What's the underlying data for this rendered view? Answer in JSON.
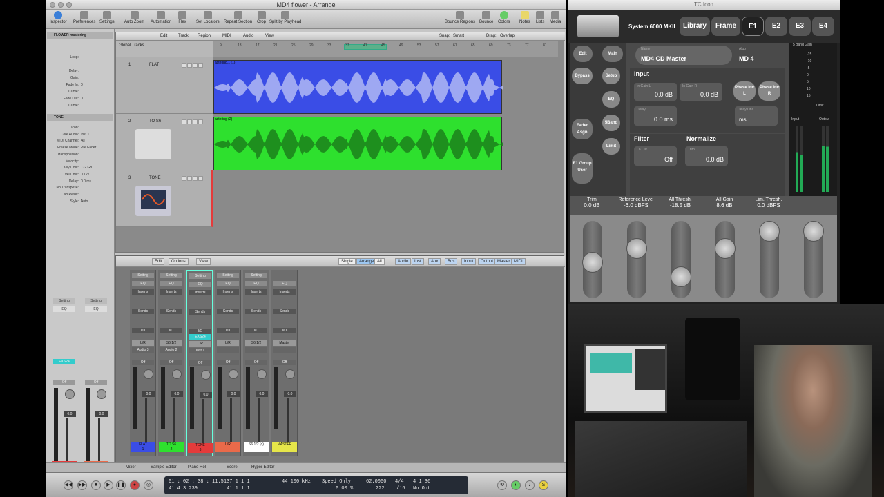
{
  "window": {
    "title": "MD4 flower - Arrange"
  },
  "toolbar": {
    "left": [
      "Inspector",
      "Preferences",
      "Settings"
    ],
    "center": [
      "Auto Zoom",
      "Automation",
      "Flex",
      "Set Locators",
      "Repeat Section",
      "Crop",
      "Split by Playhead"
    ],
    "right": [
      "Bounce Regions",
      "Bounce",
      "Colors",
      "Notes",
      "Lists",
      "Media"
    ]
  },
  "inspector": {
    "region_title": "FLOWER mastering",
    "region_params": [
      {
        "k": "Loop:",
        "v": ""
      },
      {
        "k": "Delay:",
        "v": ""
      },
      {
        "k": "Gain:",
        "v": ""
      },
      {
        "k": "Fade In:",
        "v": "0"
      },
      {
        "k": "Curve:",
        "v": ""
      },
      {
        "k": "Fade Out:",
        "v": "0"
      },
      {
        "k": "Curve:",
        "v": ""
      }
    ],
    "track_title": "TONE",
    "track_params": [
      {
        "k": "Icon:",
        "v": ""
      },
      {
        "k": "Core Audio:",
        "v": "Inst 1"
      },
      {
        "k": "MIDI Channel:",
        "v": "All"
      },
      {
        "k": "Freeze Mode:",
        "v": "Pre Fader"
      },
      {
        "k": "Transposition:",
        "v": ""
      },
      {
        "k": "Velocity:",
        "v": ""
      },
      {
        "k": "Key Limit:",
        "v": "C-2  G8"
      },
      {
        "k": "Vel Limit:",
        "v": "0   127"
      },
      {
        "k": "Delay:",
        "v": "0.0 ms"
      },
      {
        "k": "No Transpose:",
        "v": ""
      },
      {
        "k": "No Reset:",
        "v": ""
      },
      {
        "k": "Style:",
        "v": "Auto"
      }
    ]
  },
  "arrange": {
    "menus": [
      "Edit",
      "Track",
      "Region",
      "MIDI",
      "Audio",
      "View"
    ],
    "snap_label": "Snap:",
    "snap_value": "Smart",
    "drag_label": "Drag:",
    "drag_value": "Overlap",
    "global_tracks": "Global Tracks",
    "ruler": [
      "9",
      "13",
      "17",
      "21",
      "25",
      "29",
      "33",
      "37",
      "41",
      "45",
      "49",
      "53",
      "57",
      "61",
      "65",
      "69",
      "73",
      "77",
      "81"
    ],
    "tracks": [
      {
        "num": "1",
        "name": "FLAT",
        "region": "astering.1 (1)",
        "color": "#3a4de6"
      },
      {
        "num": "2",
        "name": "TO S6",
        "region": "astering (2)",
        "color": "#2ee02e"
      },
      {
        "num": "3",
        "name": "TONE",
        "region": "",
        "color": ""
      }
    ]
  },
  "mixer": {
    "menus": [
      "Edit",
      "Options",
      "View"
    ],
    "view_tabs": [
      "Single",
      "Arrange",
      "All"
    ],
    "filter_tabs": [
      "Audio",
      "Inst",
      "Aux",
      "Bus",
      "Input",
      "Output",
      "Master",
      "MIDI"
    ],
    "strips": [
      {
        "setting": "Setting",
        "io": "L/R",
        "out": "Audio 3",
        "name": "FLAT",
        "num": "1",
        "color": "#3a4de6",
        "vol": "0.0"
      },
      {
        "setting": "Setting",
        "io": "S6 1/2",
        "out": "Audio 2",
        "name": "TO S6",
        "num": "2",
        "color": "#2ee02e",
        "vol": "0.0"
      },
      {
        "setting": "Setting",
        "io": "L/R",
        "out": "Inst 1",
        "name": "TONE",
        "num": "3",
        "color": "#e43b3b",
        "vol": "0.0",
        "inst": "EXS24"
      },
      {
        "setting": "Setting",
        "io": "L/R",
        "out": "",
        "name": "L/R",
        "num": "",
        "color": "#ea6a4a",
        "vol": "0.0"
      },
      {
        "setting": "Setting",
        "io": "S6 1/2",
        "out": "",
        "name": "S6 1/2 (o)",
        "num": "",
        "color": "#ffffff",
        "vol": "0.0"
      },
      {
        "setting": "",
        "io": "Master",
        "out": "",
        "name": "MASTER",
        "num": "",
        "color": "#e6e64a",
        "vol": "0.0"
      }
    ],
    "strip_labels": {
      "eq": "EQ",
      "inserts": "Inserts",
      "sends": "Sends",
      "io": "I/O",
      "off": "Off"
    },
    "inspector_strips": [
      {
        "name": "TONE",
        "vol": "0.0",
        "inst": "EXS24",
        "color": "#e43b3b"
      },
      {
        "name": "L/R",
        "vol": "0.0",
        "color": "#ea6a4a"
      }
    ]
  },
  "bottom_tabs": [
    "Mixer",
    "Sample Editor",
    "Piano Roll",
    "Score",
    "Hyper Editor"
  ],
  "transport": {
    "smpte": "01 : 02 : 38 : 11.51",
    "bars": "37   1   1   1",
    "bars2": "41   4   3   239",
    "bars3": "37   1   1   1",
    "bars4": "41   1   1   1",
    "sample_rate": "44.100 kHz",
    "mode": "Speed Only",
    "percent": "0.00 %",
    "tempo": "62.0000",
    "tempo2": "222",
    "sig": "4/4",
    "div": "/16",
    "pos": "4   1   36",
    "in": "No In",
    "out": "No Out"
  },
  "tc": {
    "window_title": "TC Icon",
    "device": "System 6000 MKII",
    "tabs": [
      "Library",
      "Frame",
      "E1",
      "E2",
      "E3",
      "E4"
    ],
    "active_tab": "E1",
    "left_pills": [
      "Edit",
      "Bypass",
      "Fader Asgn",
      "E1 Group User"
    ],
    "mid_pills": [
      "Main",
      "Setup",
      "EQ",
      "5Band",
      "Limit"
    ],
    "name_label": "Name",
    "name_value": "MD4 CD Master",
    "algo_label": "Algo",
    "algo_value": "MD 4",
    "input": {
      "title": "Input",
      "gain_l_label": "In Gain L",
      "gain_l": "0.0 dB",
      "gain_r_label": "In Gain R",
      "gain_r": "0.0 dB",
      "phase_l": "Phase Inv L",
      "phase_r": "Phase Inv R",
      "delay_label": "Delay",
      "delay": "0.0 ms",
      "delay_unit_label": "Delay Unit",
      "delay_unit": "ms"
    },
    "filter": {
      "title": "Filter",
      "locut_label": "Lo Cut",
      "locut": "Off"
    },
    "normalize": {
      "title": "Normalize",
      "trim_label": "Trim",
      "trim": "0.0 dB"
    },
    "meters": {
      "title": "5 Band Gain",
      "limit": "Limit",
      "input": "Input",
      "output": "Output",
      "scale": [
        "-15",
        "-10",
        "-5",
        "0",
        "5",
        "10",
        "15"
      ]
    },
    "params": [
      {
        "label": "Trim",
        "value": "0.0 dB"
      },
      {
        "label": "Reference Level",
        "value": "-6.0 dBFS"
      },
      {
        "label": "All Thresh.",
        "value": "-18.5 dB"
      },
      {
        "label": "All Gain",
        "value": "8.6 dB"
      },
      {
        "label": "Lim. Thresh.",
        "value": "0.0 dBFS"
      }
    ],
    "fader_levels": [
      0.45,
      0.7,
      0.2,
      0.7,
      1.0,
      1.0
    ]
  }
}
